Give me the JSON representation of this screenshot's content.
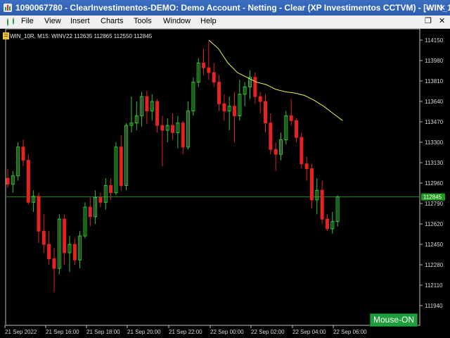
{
  "window": {
    "title": "1090067780 - ClearInvestimentos-DEMO: Demo Account - Netting - Clear (XP Investimentos CCTVM) - [WIN_1...",
    "minimize_glyph": "–",
    "close_glyph": "✕"
  },
  "menu": {
    "items": [
      "File",
      "View",
      "Insert",
      "Charts",
      "Tools",
      "Window",
      "Help"
    ],
    "restore_glyph": "❐",
    "close_glyph": "✕"
  },
  "chart": {
    "info": "WIN_10R, M15:  WINV22  112635 112865 112550 112845",
    "price_ticks": [
      "114150",
      "113980",
      "113810",
      "113640",
      "113470",
      "113300",
      "113130",
      "112960",
      "112790",
      "112620",
      "112450",
      "112280",
      "112110",
      "111940"
    ],
    "price_tick_values": [
      114150,
      113980,
      113810,
      113640,
      113470,
      113300,
      113130,
      112960,
      112790,
      112620,
      112450,
      112280,
      112110,
      111940
    ],
    "time_ticks": [
      "21 Sep 2022",
      "21 Sep 16:00",
      "21 Sep 18:00",
      "21 Sep 20:00",
      "21 Sep 22:00",
      "22 Sep 00:00",
      "22 Sep 02:00",
      "22 Sep 04:00",
      "22 Sep 06:00"
    ],
    "current_price": "112845",
    "current_price_value": 112845,
    "bull_color": "#32c832",
    "bear_color": "#e6231e",
    "ma_color": "#f0f04a",
    "candles": [
      {
        "o": 113000,
        "h": 113080,
        "l": 112920,
        "c": 112950
      },
      {
        "o": 112950,
        "h": 113060,
        "l": 112880,
        "c": 113020
      },
      {
        "o": 113020,
        "h": 113300,
        "l": 112980,
        "c": 113260
      },
      {
        "o": 113260,
        "h": 113320,
        "l": 113100,
        "c": 113150
      },
      {
        "o": 113150,
        "h": 113200,
        "l": 112780,
        "c": 112800
      },
      {
        "o": 112800,
        "h": 112900,
        "l": 112720,
        "c": 112850
      },
      {
        "o": 112850,
        "h": 112880,
        "l": 112460,
        "c": 112560
      },
      {
        "o": 112560,
        "h": 112700,
        "l": 112380,
        "c": 112450
      },
      {
        "o": 112450,
        "h": 112560,
        "l": 112280,
        "c": 112330
      },
      {
        "o": 112330,
        "h": 112420,
        "l": 112050,
        "c": 112250
      },
      {
        "o": 112250,
        "h": 112700,
        "l": 112200,
        "c": 112660
      },
      {
        "o": 112660,
        "h": 112700,
        "l": 112280,
        "c": 112380
      },
      {
        "o": 112380,
        "h": 112520,
        "l": 112220,
        "c": 112450
      },
      {
        "o": 112450,
        "h": 112500,
        "l": 112280,
        "c": 112320
      },
      {
        "o": 112320,
        "h": 112560,
        "l": 112250,
        "c": 112520
      },
      {
        "o": 112520,
        "h": 112800,
        "l": 112500,
        "c": 112760
      },
      {
        "o": 112760,
        "h": 112840,
        "l": 112600,
        "c": 112680
      },
      {
        "o": 112680,
        "h": 112900,
        "l": 112620,
        "c": 112840
      },
      {
        "o": 112840,
        "h": 112880,
        "l": 112760,
        "c": 112800
      },
      {
        "o": 112800,
        "h": 113000,
        "l": 112740,
        "c": 112940
      },
      {
        "o": 112940,
        "h": 113000,
        "l": 112820,
        "c": 112880
      },
      {
        "o": 112880,
        "h": 113300,
        "l": 112860,
        "c": 113260
      },
      {
        "o": 113260,
        "h": 113360,
        "l": 112900,
        "c": 112940
      },
      {
        "o": 112940,
        "h": 113460,
        "l": 112900,
        "c": 113440
      },
      {
        "o": 113440,
        "h": 113680,
        "l": 113380,
        "c": 113460
      },
      {
        "o": 113460,
        "h": 113640,
        "l": 113400,
        "c": 113520
      },
      {
        "o": 113520,
        "h": 113720,
        "l": 113430,
        "c": 113680
      },
      {
        "o": 113680,
        "h": 113730,
        "l": 113450,
        "c": 113560
      },
      {
        "o": 113560,
        "h": 113700,
        "l": 113480,
        "c": 113640
      },
      {
        "o": 113640,
        "h": 113660,
        "l": 113380,
        "c": 113440
      },
      {
        "o": 113440,
        "h": 113520,
        "l": 113100,
        "c": 113400
      },
      {
        "o": 113400,
        "h": 113500,
        "l": 113300,
        "c": 113440
      },
      {
        "o": 113440,
        "h": 113540,
        "l": 113320,
        "c": 113380
      },
      {
        "o": 113380,
        "h": 113520,
        "l": 113250,
        "c": 113460
      },
      {
        "o": 113460,
        "h": 113480,
        "l": 113200,
        "c": 113260
      },
      {
        "o": 113260,
        "h": 113640,
        "l": 113240,
        "c": 113560
      },
      {
        "o": 113560,
        "h": 113840,
        "l": 113520,
        "c": 113800
      },
      {
        "o": 113800,
        "h": 114000,
        "l": 113760,
        "c": 113960
      },
      {
        "o": 113960,
        "h": 114080,
        "l": 113860,
        "c": 113920
      },
      {
        "o": 113920,
        "h": 114140,
        "l": 113820,
        "c": 113880
      },
      {
        "o": 113880,
        "h": 113960,
        "l": 113760,
        "c": 113800
      },
      {
        "o": 113800,
        "h": 113860,
        "l": 113560,
        "c": 113620
      },
      {
        "o": 113620,
        "h": 113700,
        "l": 113480,
        "c": 113560
      },
      {
        "o": 113560,
        "h": 113680,
        "l": 113400,
        "c": 113600
      },
      {
        "o": 113600,
        "h": 113720,
        "l": 113300,
        "c": 113520
      },
      {
        "o": 113520,
        "h": 113820,
        "l": 113480,
        "c": 113700
      },
      {
        "o": 113700,
        "h": 113800,
        "l": 113600,
        "c": 113760
      },
      {
        "o": 113760,
        "h": 113900,
        "l": 113660,
        "c": 113840
      },
      {
        "o": 113840,
        "h": 113880,
        "l": 113620,
        "c": 113680
      },
      {
        "o": 113680,
        "h": 113720,
        "l": 113540,
        "c": 113640
      },
      {
        "o": 113640,
        "h": 113700,
        "l": 113380,
        "c": 113460
      },
      {
        "o": 113460,
        "h": 113540,
        "l": 113200,
        "c": 113240
      },
      {
        "o": 113240,
        "h": 113300,
        "l": 113060,
        "c": 113200
      },
      {
        "o": 113200,
        "h": 113380,
        "l": 113150,
        "c": 113320
      },
      {
        "o": 113320,
        "h": 113560,
        "l": 113280,
        "c": 113520
      },
      {
        "o": 113520,
        "h": 113660,
        "l": 113440,
        "c": 113480
      },
      {
        "o": 113480,
        "h": 113500,
        "l": 113300,
        "c": 113340
      },
      {
        "o": 113340,
        "h": 113380,
        "l": 113080,
        "c": 113120
      },
      {
        "o": 113120,
        "h": 113180,
        "l": 112980,
        "c": 113080
      },
      {
        "o": 113080,
        "h": 113120,
        "l": 112750,
        "c": 112820
      },
      {
        "o": 112820,
        "h": 113000,
        "l": 112700,
        "c": 112900
      },
      {
        "o": 112900,
        "h": 112980,
        "l": 112620,
        "c": 112660
      },
      {
        "o": 112660,
        "h": 112700,
        "l": 112560,
        "c": 112580
      },
      {
        "o": 112580,
        "h": 112720,
        "l": 112540,
        "c": 112640
      },
      {
        "o": 112640,
        "h": 112860,
        "l": 112600,
        "c": 112845
      }
    ],
    "ma": [
      114150,
      114080,
      113960,
      113880,
      113840,
      113800,
      113780,
      113740,
      113720,
      113710,
      113690,
      113650,
      113600,
      113540,
      113480
    ]
  },
  "mouse_button": "Mouse-ON"
}
